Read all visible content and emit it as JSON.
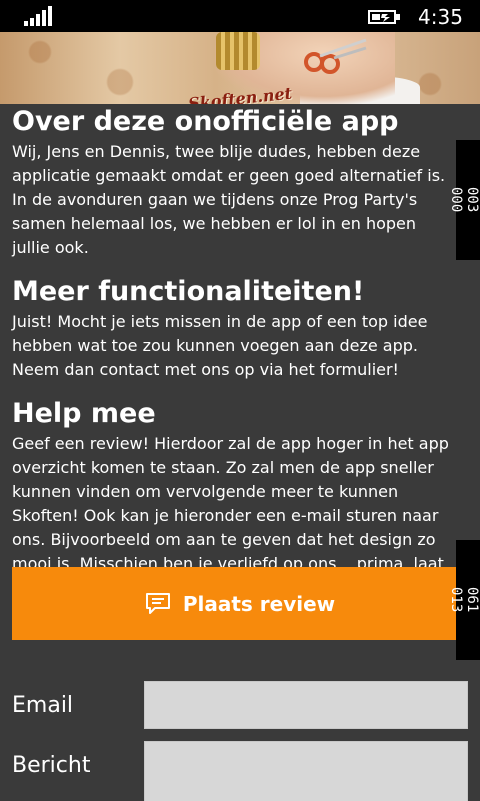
{
  "status": {
    "time": "4:35",
    "icons": [
      "signal-icon",
      "battery-charging-icon"
    ]
  },
  "banner": {
    "logo_text": "Skoften.net"
  },
  "sections": [
    {
      "title": "Over deze onofficiële app",
      "body": "Wij, Jens en Dennis, twee blije dudes, hebben deze applicatie gemaakt omdat er geen goed alternatief is. In de avonduren gaan we tijdens onze Prog Party's samen helemaal los, we hebben er lol in en hopen jullie ook."
    },
    {
      "title": "Meer functionaliteiten!",
      "body": "Juist! Mocht je iets missen in de app of een top idee hebben wat toe zou kunnen voegen aan deze app. Neem dan contact met ons op via het formulier!"
    },
    {
      "title": "Help mee",
      "body": "Geef een review! Hierdoor zal de app hoger in het app overzicht komen te staan. Zo zal men de app sneller kunnen vinden om vervolgende meer te kunnen Skoften! Ook kan je hieronder een e-mail sturen naar ons. Bijvoorbeeld om aan te geven dat het design zo mooi is. Misschien ben je verliefd op ons... prima, laat het ons weten."
    }
  ],
  "review_button": {
    "label": "Plaats review",
    "icon": "chat-bubble-icon",
    "color": "#f78a0c"
  },
  "form": {
    "email_label": "Email",
    "email_value": "",
    "message_label": "Bericht",
    "message_value": ""
  },
  "counters": {
    "top": [
      "003",
      "000"
    ],
    "bottom": [
      "061",
      "013"
    ]
  },
  "colors": {
    "background": "#3a3a3a",
    "accent": "#f78a0c",
    "field": "#d7d7d7"
  }
}
